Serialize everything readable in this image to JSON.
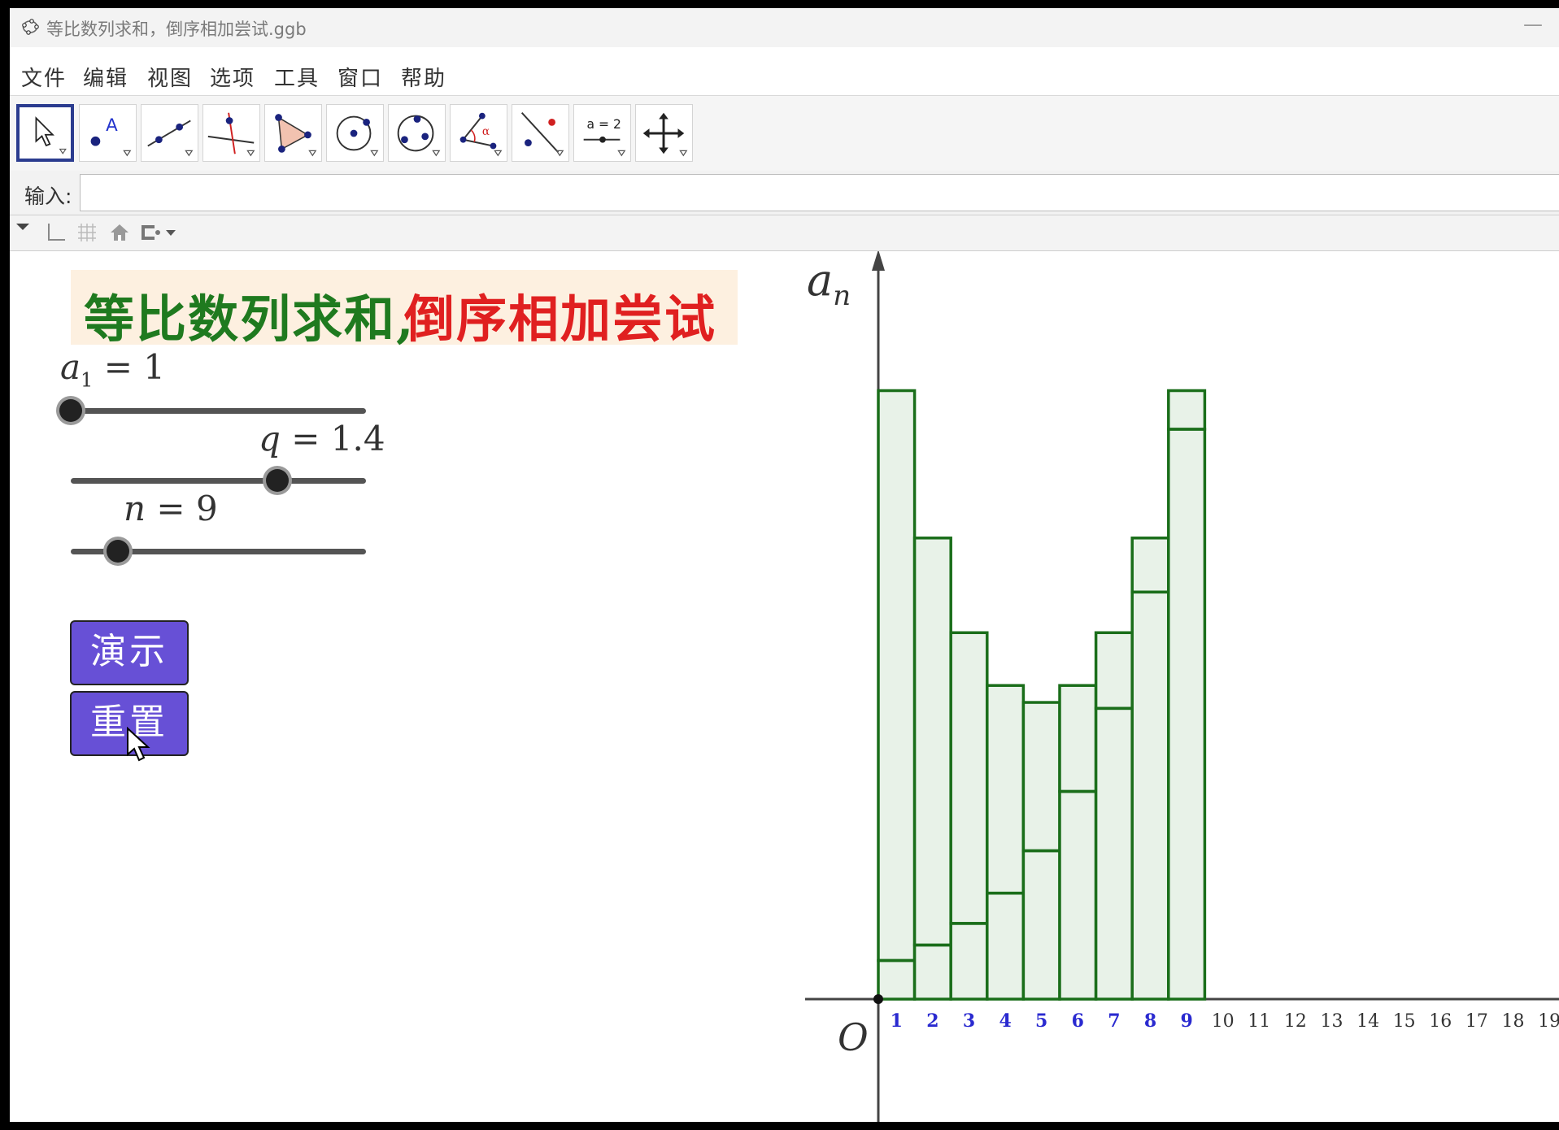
{
  "window": {
    "title": "等比数列求和，倒序相加尝试.ggb",
    "minimize": "—"
  },
  "menu": [
    "文件",
    "编辑",
    "视图",
    "选项",
    "工具",
    "窗口",
    "帮助"
  ],
  "toolbar": {
    "tools": [
      "move",
      "point",
      "line",
      "perpendicular",
      "polygon",
      "circle",
      "conic",
      "angle",
      "reflect",
      "slider",
      "move-graphics"
    ],
    "slider_tool_label": "a = 2"
  },
  "input": {
    "label": "输入:",
    "value": ""
  },
  "banner": {
    "part1": "等比数列求和,",
    "part2": "倒序相加尝试",
    "color1": "#1f7a1f",
    "color2": "#e02020"
  },
  "sliders": [
    {
      "var": "a",
      "sub": "1",
      "eq": "= 1",
      "value": 1,
      "min": 1,
      "max": 10
    },
    {
      "var": "q",
      "eq": "= 1.4",
      "value": 1.4,
      "min": 0,
      "max": 2
    },
    {
      "var": "n",
      "eq": "= 9",
      "value": 9,
      "min": 5,
      "max": 30
    }
  ],
  "buttons": {
    "demo": "演示",
    "reset": "重置"
  },
  "axes": {
    "y_label_base": "a",
    "y_label_sub": "n",
    "origin": "O",
    "x_ticks": [
      "1",
      "2",
      "3",
      "4",
      "5",
      "6",
      "7",
      "8",
      "9",
      "10",
      "11",
      "12",
      "13",
      "14",
      "15",
      "16",
      "17",
      "18",
      "19"
    ]
  },
  "chart_data": {
    "type": "bar",
    "categories": [
      1,
      2,
      3,
      4,
      5,
      6,
      7,
      8,
      9
    ],
    "series": [
      {
        "values": [
          1,
          1.4,
          1.96,
          2.744,
          3.8416,
          5.3782,
          7.5295,
          10.5414,
          14.7579
        ]
      },
      {
        "values": [
          14.7579,
          10.5414,
          7.5295,
          5.3782,
          3.8416,
          2.744,
          1.96,
          1.4,
          1
        ]
      }
    ],
    "bar_stroke": "#1a6e1a",
    "bar_fill": "#e8f2e8"
  }
}
